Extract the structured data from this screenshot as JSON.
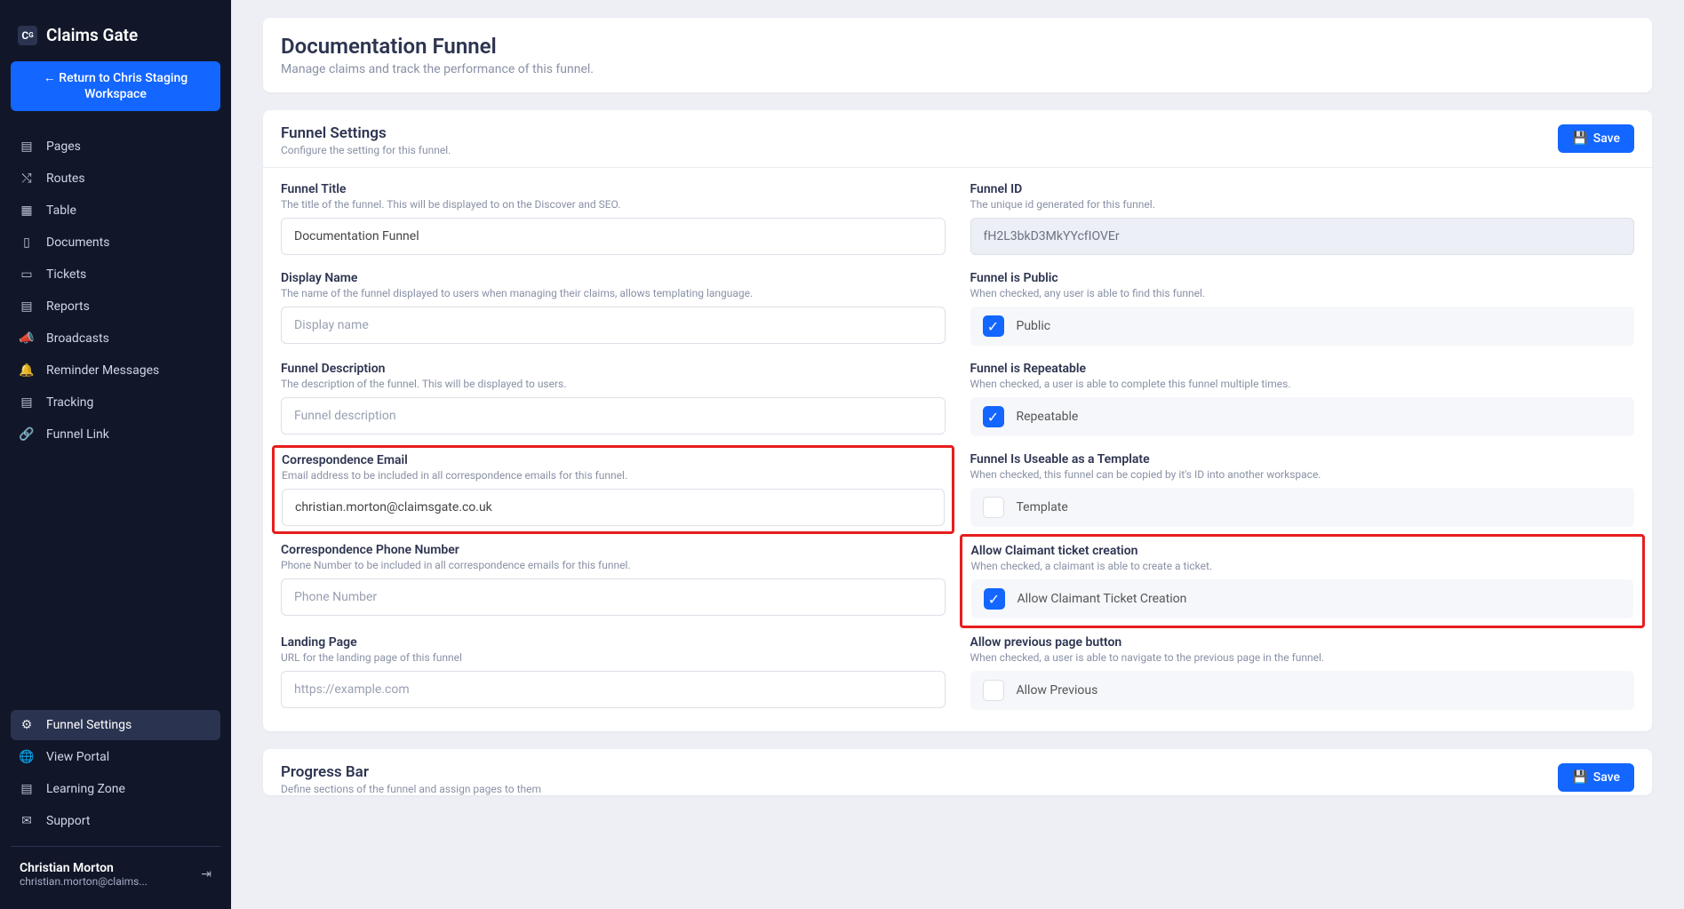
{
  "brand": "Claims Gate",
  "return_btn": "← Return to Chris Staging Workspace",
  "nav": {
    "pages": "Pages",
    "routes": "Routes",
    "table": "Table",
    "documents": "Documents",
    "tickets": "Tickets",
    "reports": "Reports",
    "broadcasts": "Broadcasts",
    "reminder": "Reminder Messages",
    "tracking": "Tracking",
    "funnel_link": "Funnel Link",
    "funnel_settings": "Funnel Settings",
    "view_portal": "View Portal",
    "learning_zone": "Learning Zone",
    "support": "Support"
  },
  "user": {
    "name": "Christian Morton",
    "email": "christian.morton@claims..."
  },
  "hero": {
    "title": "Documentation Funnel",
    "subtitle": "Manage claims and track the performance of this funnel."
  },
  "settings": {
    "title": "Funnel Settings",
    "subtitle": "Configure the setting for this funnel.",
    "save": "Save"
  },
  "left": {
    "funnel_title": {
      "label": "Funnel Title",
      "desc": "The title of the funnel. This will be displayed to on the Discover and SEO.",
      "value": "Documentation Funnel"
    },
    "display_name": {
      "label": "Display Name",
      "desc": "The name of the funnel displayed to users when managing their claims, allows templating language.",
      "placeholder": "Display name"
    },
    "funnel_desc": {
      "label": "Funnel Description",
      "desc": "The description of the funnel. This will be displayed to users.",
      "placeholder": "Funnel description"
    },
    "corr_email": {
      "label": "Correspondence Email",
      "desc": "Email address to be included in all correspondence emails for this funnel.",
      "value": "christian.morton@claimsgate.co.uk"
    },
    "corr_phone": {
      "label": "Correspondence Phone Number",
      "desc": "Phone Number to be included in all correspondence emails for this funnel.",
      "placeholder": "Phone Number"
    },
    "landing": {
      "label": "Landing Page",
      "desc": "URL for the landing page of this funnel",
      "placeholder": "https://example.com"
    }
  },
  "right": {
    "funnel_id": {
      "label": "Funnel ID",
      "desc": "The unique id generated for this funnel.",
      "value": "fH2L3bkD3MkYYcfIOVEr"
    },
    "public": {
      "label": "Funnel is Public",
      "desc": "When checked, any user is able to find this funnel.",
      "check": "Public"
    },
    "repeatable": {
      "label": "Funnel is Repeatable",
      "desc": "When checked, a user is able to complete this funnel multiple times.",
      "check": "Repeatable"
    },
    "template": {
      "label": "Funnel Is Useable as a Template",
      "desc": "When checked, this funnel can be copied by it's ID into another workspace.",
      "check": "Template"
    },
    "ticket": {
      "label": "Allow Claimant ticket creation",
      "desc": "When checked, a claimant is able to create a ticket.",
      "check": "Allow Claimant Ticket Creation"
    },
    "previous": {
      "label": "Allow previous page button",
      "desc": "When checked, a user is able to navigate to the previous page in the funnel.",
      "check": "Allow Previous"
    }
  },
  "progress": {
    "title": "Progress Bar",
    "subtitle": "Define sections of the funnel and assign pages to them",
    "save": "Save"
  }
}
